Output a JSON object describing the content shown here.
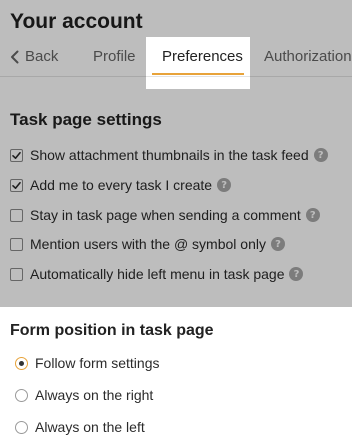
{
  "page": {
    "title": "Your account"
  },
  "tabs": {
    "back_label": "Back",
    "items": [
      {
        "label": "Profile"
      },
      {
        "label": "Preferences"
      },
      {
        "label": "Authorization"
      }
    ],
    "active": "Preferences",
    "accent_color": "#e8a33a"
  },
  "task_settings": {
    "title": "Task page settings",
    "options": [
      {
        "label": "Show attachment thumbnails in the task feed",
        "checked": true
      },
      {
        "label": "Add me to every task I create",
        "checked": true
      },
      {
        "label": "Stay in task page when sending a comment",
        "checked": false
      },
      {
        "label": "Mention users with the @ symbol only",
        "checked": false
      },
      {
        "label": "Automatically hide left menu in task page",
        "checked": false
      }
    ],
    "help_glyph": "?"
  },
  "form_position": {
    "title": "Form position in task page",
    "options": [
      {
        "label": "Follow form settings",
        "selected": true
      },
      {
        "label": "Always on the right",
        "selected": false
      },
      {
        "label": "Always on the left",
        "selected": false
      }
    ]
  }
}
